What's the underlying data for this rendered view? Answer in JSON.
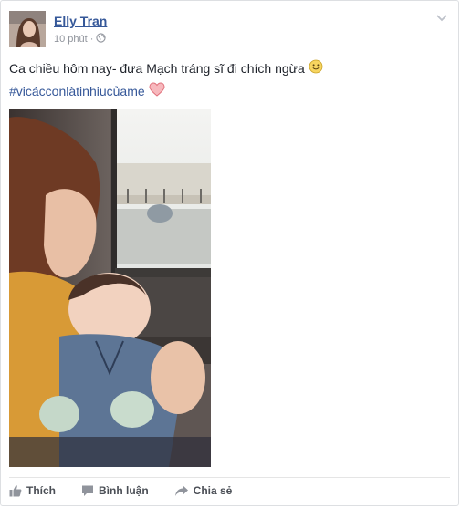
{
  "post": {
    "author": "Elly Tran",
    "time": "10 phút",
    "separator": "·",
    "privacy_icon": "globe-icon",
    "menu_icon": "chevron-down-icon",
    "text_line1": "Ca chiều hôm nay- đưa Mạch tráng sĩ đi chích ngừa",
    "emoji_1": "smile-emoji",
    "hashtag": "#vicácconlàtinhiucủame",
    "emoji_2": "heart-emoji"
  },
  "actions": {
    "like": "Thích",
    "comment": "Bình luận",
    "share": "Chia sẻ"
  },
  "colors": {
    "link": "#365899",
    "meta": "#90949c",
    "text": "#1d2129",
    "action": "#4b4f56"
  }
}
